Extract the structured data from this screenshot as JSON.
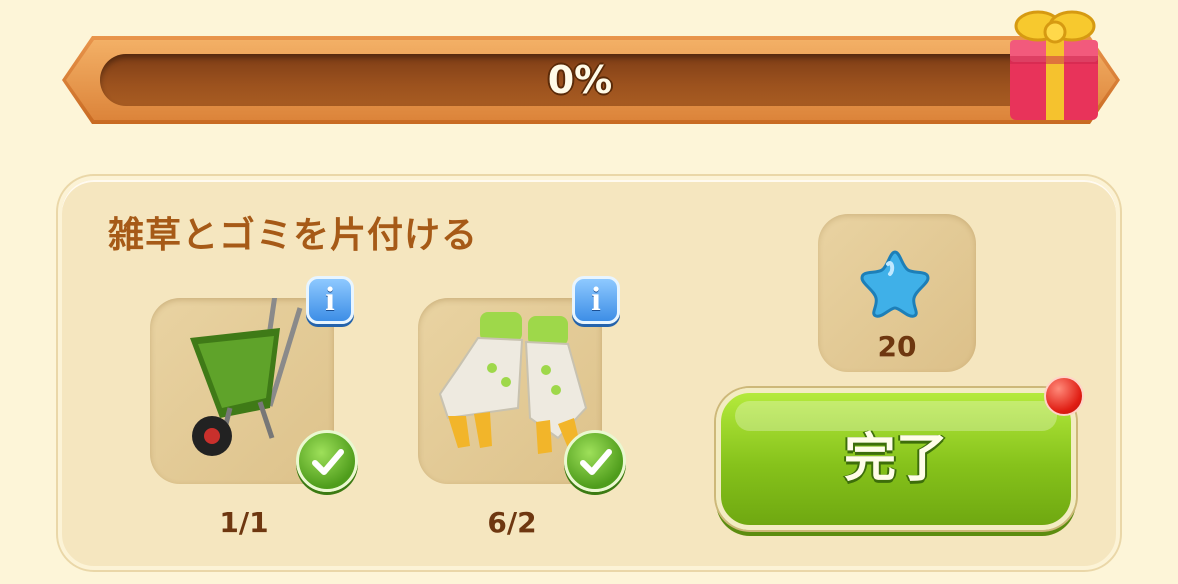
{
  "progress": {
    "percent_label": "0%",
    "value": 0
  },
  "task": {
    "title": "雑草とゴミを片付ける",
    "items": [
      {
        "icon": "wheelbarrow-icon",
        "count_label": "1/1",
        "completed": true
      },
      {
        "icon": "gardening-gloves-icon",
        "count_label": "6/2",
        "completed": true
      }
    ],
    "reward": {
      "icon": "blue-star-icon",
      "count": "20"
    }
  },
  "complete_button": {
    "label": "完了",
    "has_notification": true
  },
  "colors": {
    "title": "#a65a17",
    "button_green": "#86c21b",
    "check_green": "#4f9d1c",
    "info_blue": "#3d8ee6",
    "star_blue": "#3fb0e8"
  }
}
